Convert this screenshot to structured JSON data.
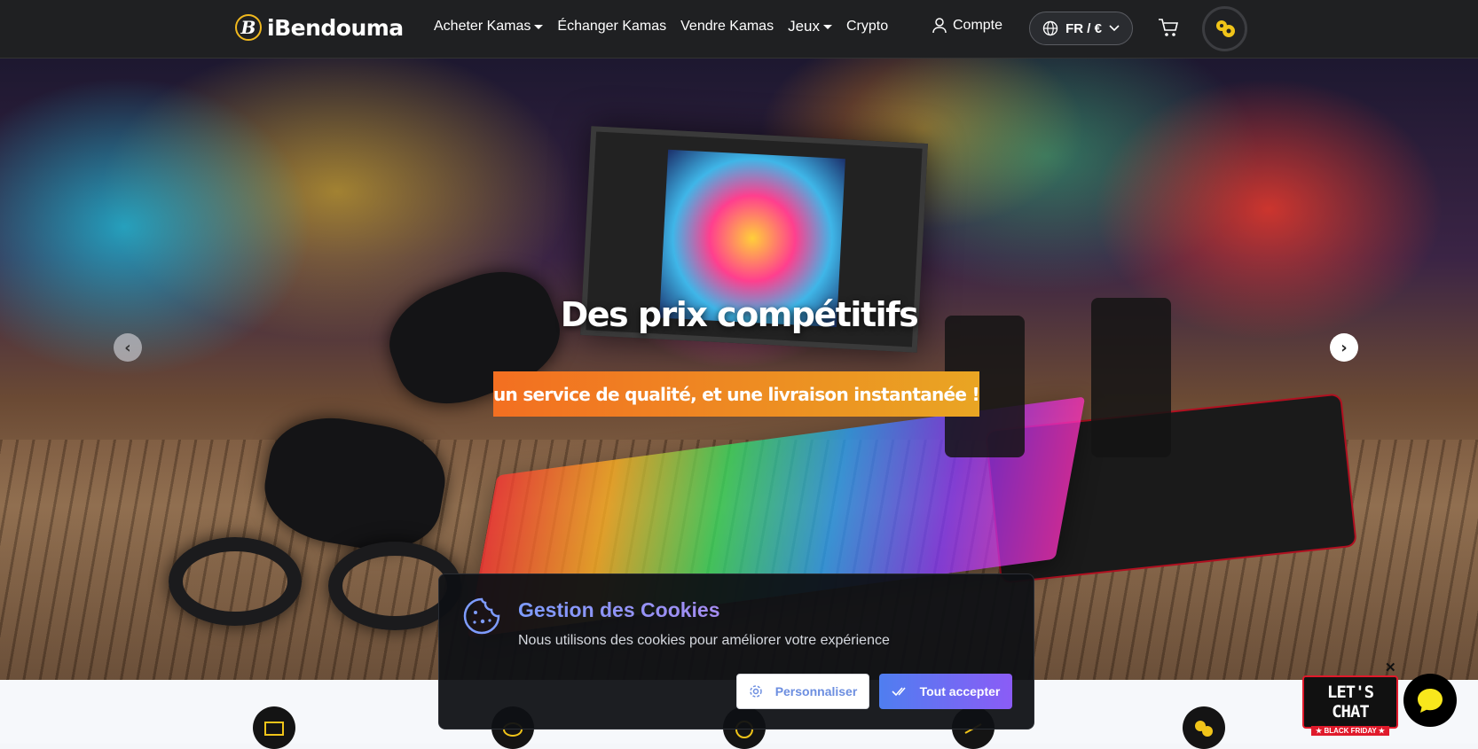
{
  "header": {
    "logo_letter": "B",
    "logo_text": "iBendouma",
    "nav": [
      {
        "label": "Acheter Kamas",
        "dropdown": true
      },
      {
        "label": "Échanger Kamas",
        "dropdown": false
      },
      {
        "label": "Vendre Kamas",
        "dropdown": false
      },
      {
        "label": "Jeux",
        "dropdown": true
      },
      {
        "label": "Crypto",
        "dropdown": false
      }
    ],
    "account_label": "Compte",
    "language_currency": "FR / €",
    "cart_icon": "cart-icon",
    "game_icon": "game-avatar-icon"
  },
  "hero": {
    "title": "Des prix compétitifs",
    "subtitle": "un service de qualité, et une livraison instantanée !",
    "prev_glyph": "‹",
    "next_glyph": "›"
  },
  "cookie_banner": {
    "title": "Gestion des Cookies",
    "text": "Nous utilisons des cookies pour améliorer votre expérience",
    "customize_label": "Personnaliser",
    "accept_label": "Tout accepter"
  },
  "chat": {
    "badge_line1": "LET'S CHAT",
    "badge_line2": "★ BLACK FRIDAY ★",
    "close_glyph": "✕"
  },
  "colors": {
    "topbar": "#1f2022",
    "accent_gold": "#f0b81e",
    "hero_banner_start": "#f36f21",
    "hero_banner_end": "#e9a523",
    "cookie_accent": "#7e9cff",
    "accept_start": "#4f7ef0",
    "accept_end": "#8b5cf6",
    "chat_red": "#e01a2b"
  }
}
